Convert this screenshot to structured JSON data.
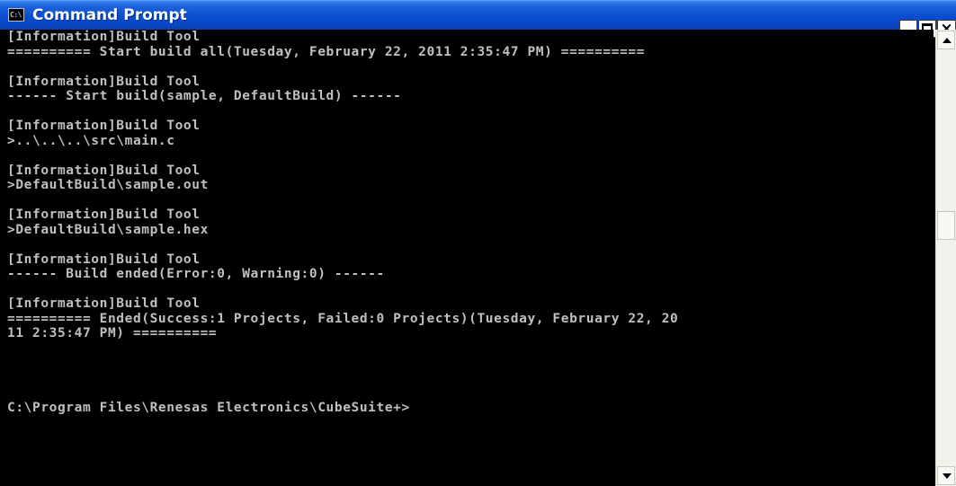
{
  "window": {
    "title": "Command Prompt",
    "icon_label": "C:\\",
    "icon": "console-icon"
  },
  "caption_buttons": {
    "minimize": "minimize-icon",
    "maximize": "maximize-icon",
    "close": "close-icon",
    "close_glyph": "×"
  },
  "console": {
    "lines": [
      "[Information]Build Tool",
      "========== Start build all(Tuesday, February 22, 2011 2:35:47 PM) ==========",
      "",
      "[Information]Build Tool",
      "------ Start build(sample, DefaultBuild) ------",
      "",
      "[Information]Build Tool",
      ">..\\..\\..\\src\\main.c",
      "",
      "[Information]Build Tool",
      ">DefaultBuild\\sample.out",
      "",
      "[Information]Build Tool",
      ">DefaultBuild\\sample.hex",
      "",
      "[Information]Build Tool",
      "------ Build ended(Error:0, Warning:0) ------",
      "",
      "[Information]Build Tool",
      "========== Ended(Success:1 Projects, Failed:0 Projects)(Tuesday, February 22, 20",
      "11 2:35:47 PM) ==========",
      "",
      "",
      "",
      "",
      "C:\\Program Files\\Renesas Electronics\\CubeSuite+>"
    ]
  },
  "colors": {
    "titlebar": "#0a4fd0",
    "console_bg": "#000000",
    "console_text": "#c0c0c0"
  }
}
